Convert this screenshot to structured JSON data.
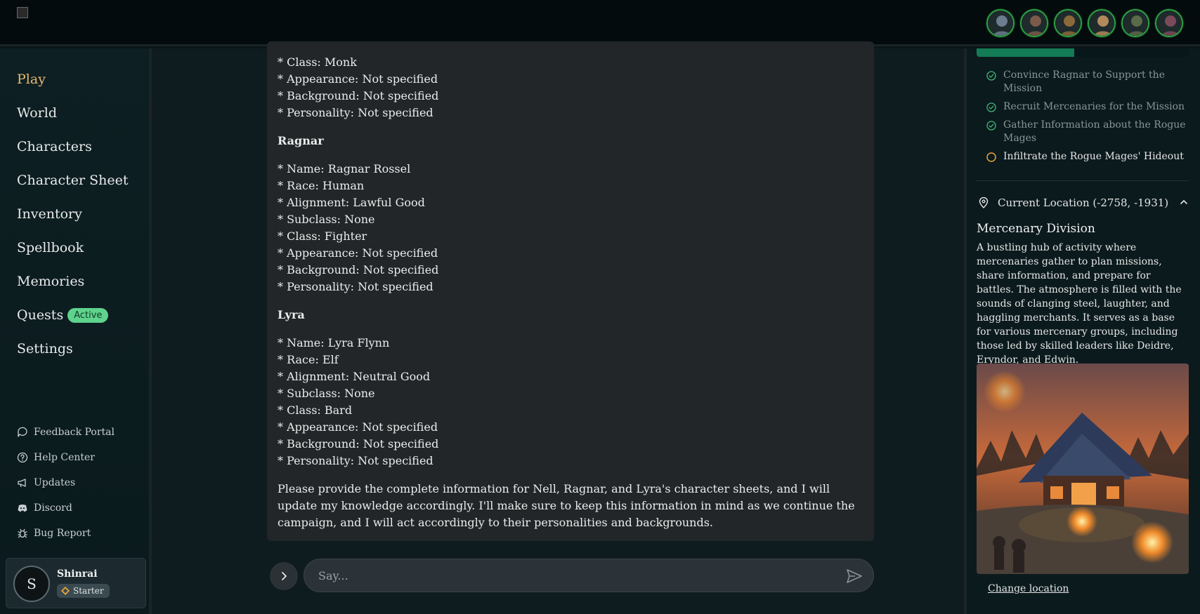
{
  "header": {
    "party_avatars": [
      {
        "name": "party-avatar-1",
        "tone": "#6b7d8f"
      },
      {
        "name": "party-avatar-2",
        "tone": "#7a5a48"
      },
      {
        "name": "party-avatar-3",
        "tone": "#8a6a3a"
      },
      {
        "name": "party-avatar-4",
        "tone": "#b08a5a"
      },
      {
        "name": "party-avatar-5",
        "tone": "#5a6a4a"
      },
      {
        "name": "party-avatar-6",
        "tone": "#7a4a5a"
      }
    ]
  },
  "sidebar": {
    "nav": [
      {
        "label": "Play",
        "active": true
      },
      {
        "label": "World"
      },
      {
        "label": "Characters"
      },
      {
        "label": "Character Sheet"
      },
      {
        "label": "Inventory"
      },
      {
        "label": "Spellbook"
      },
      {
        "label": "Memories"
      },
      {
        "label": "Quests",
        "badge": "Active"
      },
      {
        "label": "Settings"
      }
    ],
    "links": [
      {
        "label": "Feedback Portal",
        "icon": "chat-bubble-icon"
      },
      {
        "label": "Help Center",
        "icon": "help-circle-icon"
      },
      {
        "label": "Updates",
        "icon": "megaphone-icon"
      },
      {
        "label": "Discord",
        "icon": "discord-icon"
      },
      {
        "label": "Bug Report",
        "icon": "bug-icon"
      }
    ],
    "user": {
      "initial": "S",
      "name": "Shinrai",
      "tier": "Starter"
    }
  },
  "main": {
    "message": {
      "top_lines": [
        "* Class: Monk",
        "* Appearance: Not specified",
        "* Background: Not specified",
        "* Personality: Not specified"
      ],
      "sections": [
        {
          "heading": "Ragnar",
          "lines": [
            "* Name: Ragnar Rossel",
            "* Race: Human",
            "* Alignment: Lawful Good",
            "* Subclass: None",
            "* Class: Fighter",
            "* Appearance: Not specified",
            "* Background: Not specified",
            "* Personality: Not specified"
          ]
        },
        {
          "heading": "Lyra",
          "lines": [
            "* Name: Lyra Flynn",
            "* Race: Elf",
            "* Alignment: Neutral Good",
            "* Subclass: None",
            "* Class: Bard",
            "* Appearance: Not specified",
            "* Background: Not specified",
            "* Personality: Not specified"
          ]
        }
      ],
      "closing": "Please provide the complete information for Nell, Ragnar, and Lyra's character sheets, and I will update my knowledge accordingly. I'll make sure to keep this information in mind as we continue the campaign, and I will act accordingly to their personalities and backgrounds."
    },
    "input": {
      "placeholder": "Say...",
      "value": ""
    }
  },
  "right_panel": {
    "quest_progress_fraction": 0.46,
    "objectives": [
      {
        "text": "Convince Ragnar to Support the Mission",
        "status": "done"
      },
      {
        "text": "Recruit Mercenaries for the Mission",
        "status": "done"
      },
      {
        "text": "Gather Information about the Rogue Mages",
        "status": "done"
      },
      {
        "text": "Infiltrate the Rogue Mages' Hideout",
        "status": "pending"
      }
    ],
    "location": {
      "header": "Current Location (-2758, -1931)",
      "title": "Mercenary Division",
      "description": "A bustling hub of activity where mercenaries gather to plan missions, share information, and prepare for battles. The atmosphere is filled with the sounds of clanging steel, laughter, and haggling merchants. It serves as a base for various mercenary groups, including those led by skilled leaders like Deidre, Eryndor, and Edwin.",
      "change_label": "Change location"
    }
  },
  "colors": {
    "accent_active": "#e9b872",
    "badge_green": "#5fd38d",
    "progress_green": "#137b56",
    "done_check": "#3fb97a",
    "pending_circle": "#e8a33a"
  }
}
